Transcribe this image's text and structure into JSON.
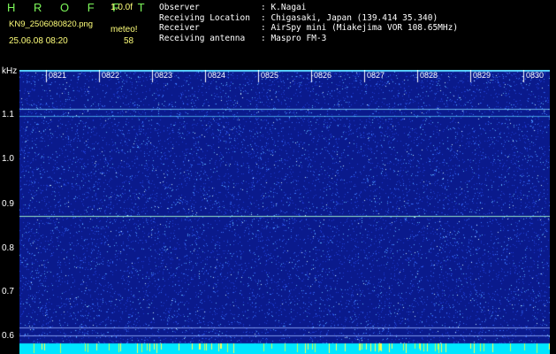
{
  "header": {
    "app_title": "H R O F F T",
    "version": "1.0.0f",
    "filename": "KN9_2506080820.png",
    "meteor_label": "meteo!",
    "datetime": "25.06.08 08:20",
    "count": "58"
  },
  "info": [
    {
      "key": "Observer",
      "value": ": K.Nagai"
    },
    {
      "key": "Receiving Location",
      "value": ": Chigasaki, Japan (139.414 35.340)"
    },
    {
      "key": "Receiver",
      "value": ": AirSpy mini (Miakejima VOR 108.65MHz)"
    },
    {
      "key": "Receiving antenna",
      "value": ": Maspro FM-3"
    }
  ],
  "axis": {
    "unit": "kHz",
    "y_labels": [
      "1.1",
      "1.0",
      "0.9",
      "0.8",
      "0.7",
      "0.6"
    ],
    "x_labels": [
      "0821",
      "0822",
      "0823",
      "0824",
      "0825",
      "0826",
      "0827",
      "0828",
      "0829",
      "0830"
    ]
  },
  "colors": {
    "background": "#0a1a8c",
    "signal": "#5ad2ff",
    "header_text": "#ffff7a",
    "title": "#7df95a"
  }
}
